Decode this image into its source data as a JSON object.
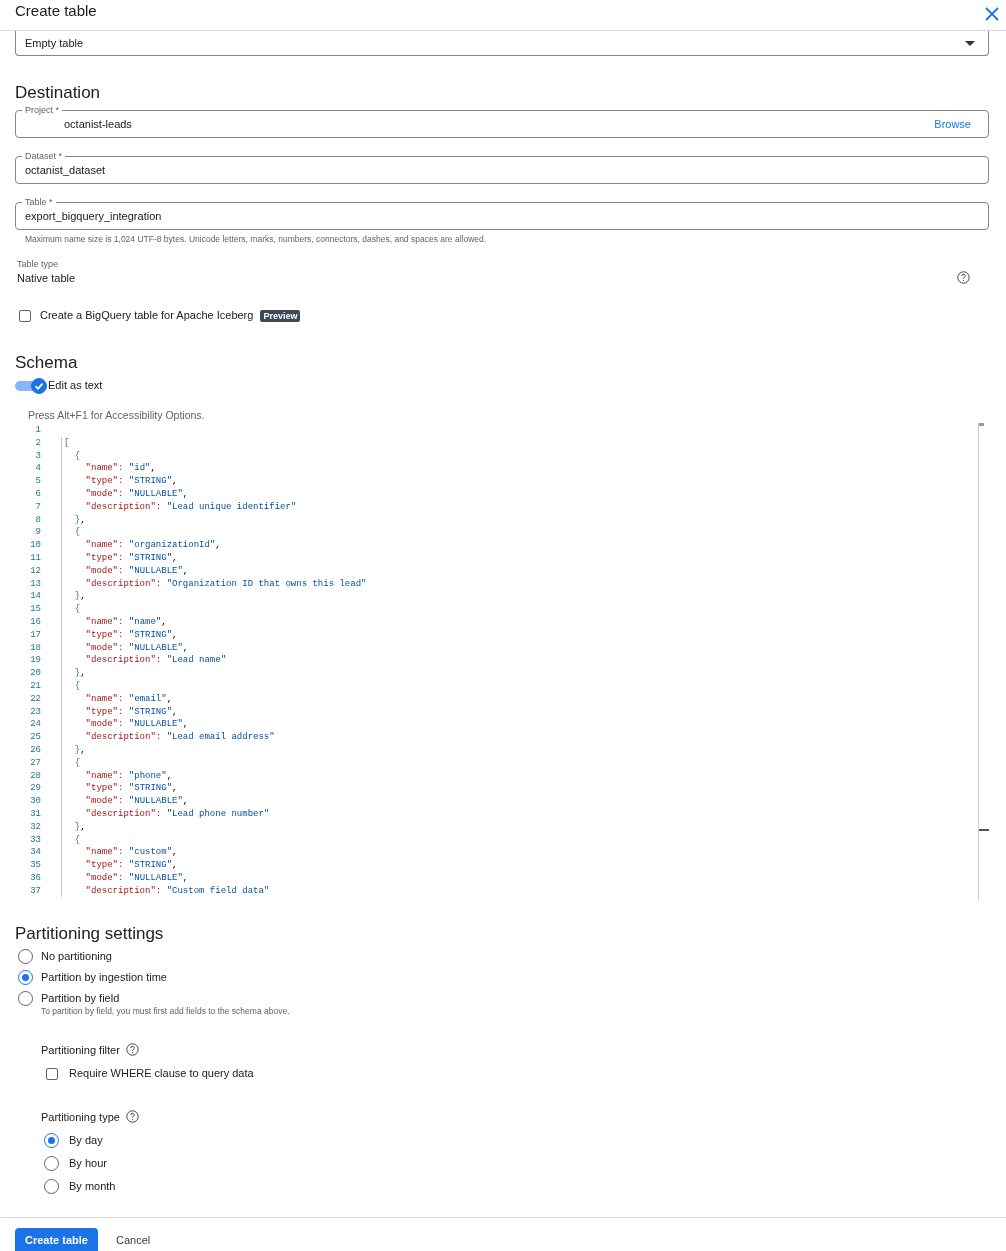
{
  "header": {
    "title": "Create table"
  },
  "source": {
    "value": "Empty table"
  },
  "destination": {
    "heading": "Destination",
    "fields": [
      {
        "label": "Project *",
        "value": "octanist-leads",
        "action": "Browse"
      },
      {
        "label": "Dataset *",
        "value": "octanist_dataset"
      },
      {
        "label": "Table *",
        "value": "export_bigquery_integration",
        "hint": "Maximum name size is 1,024 UTF-8 bytes. Unicode letters, marks, numbers, connectors, dashes, and spaces are allowed."
      }
    ],
    "table_type_label": "Table type",
    "table_type_value": "Native table",
    "iceberg": {
      "label": "Create a BigQuery table for Apache Iceberg",
      "checked": false,
      "badge": "Preview"
    }
  },
  "schema": {
    "heading": "Schema",
    "toggle": {
      "label": "Edit as text",
      "on": true
    },
    "editor_hint": "Press Alt+F1 for Accessibility Options.",
    "code_lines": [
      {
        "number": "1"
      },
      {
        "number": "2",
        "text": "["
      },
      {
        "number": "3",
        "text": "  {"
      },
      {
        "number": "4",
        "text": "    \"name\": \"id\","
      },
      {
        "number": "5",
        "text": "    \"type\": \"STRING\","
      },
      {
        "number": "6",
        "text": "    \"mode\": \"NULLABLE\","
      },
      {
        "number": "7",
        "text": "    \"description\": \"Lead unique identifier\""
      },
      {
        "number": "8",
        "text": "  },"
      },
      {
        "number": "9",
        "text": "  {"
      },
      {
        "number": "10",
        "text": "    \"name\": \"organizationId\","
      },
      {
        "number": "11",
        "text": "    \"type\": \"STRING\","
      },
      {
        "number": "12",
        "text": "    \"mode\": \"NULLABLE\","
      },
      {
        "number": "13",
        "text": "    \"description\": \"Organization ID that owns this lead\""
      },
      {
        "number": "14",
        "text": "  },"
      },
      {
        "number": "15",
        "text": "  {"
      },
      {
        "number": "16",
        "text": "    \"name\": \"name\","
      },
      {
        "number": "17",
        "text": "    \"type\": \"STRING\","
      },
      {
        "number": "18",
        "text": "    \"mode\": \"NULLABLE\","
      },
      {
        "number": "19",
        "text": "    \"description\": \"Lead name\""
      },
      {
        "number": "20",
        "text": "  },"
      },
      {
        "number": "21",
        "text": "  {"
      },
      {
        "number": "22",
        "text": "    \"name\": \"email\","
      },
      {
        "number": "23",
        "text": "    \"type\": \"STRING\","
      },
      {
        "number": "24",
        "text": "    \"mode\": \"NULLABLE\","
      },
      {
        "number": "25",
        "text": "    \"description\": \"Lead email address\""
      },
      {
        "number": "26",
        "text": "  },"
      },
      {
        "number": "27",
        "text": "  {"
      },
      {
        "number": "28",
        "text": "    \"name\": \"phone\","
      },
      {
        "number": "29",
        "text": "    \"type\": \"STRING\","
      },
      {
        "number": "30",
        "text": "    \"mode\": \"NULLABLE\","
      },
      {
        "number": "31",
        "text": "    \"description\": \"Lead phone number\""
      },
      {
        "number": "32",
        "text": "  },"
      },
      {
        "number": "33",
        "text": "  {"
      },
      {
        "number": "34",
        "text": "    \"name\": \"custom\","
      },
      {
        "number": "35",
        "text": "    \"type\": \"STRING\","
      },
      {
        "number": "36",
        "text": "    \"mode\": \"NULLABLE\","
      },
      {
        "number": "37",
        "text": "    \"description\": \"Custom field data\""
      }
    ]
  },
  "partitioning": {
    "heading": "Partitioning settings",
    "options": [
      {
        "label": "No partitioning",
        "selected": false
      },
      {
        "label": "Partition by ingestion time",
        "selected": true
      },
      {
        "label": "Partition by field",
        "selected": false,
        "hint": "To partition by field, you must first add fields to the schema above."
      }
    ],
    "filter": {
      "label": "Partitioning filter",
      "checkbox": {
        "label": "Require WHERE clause to query data",
        "checked": false
      }
    },
    "type": {
      "label": "Partitioning type",
      "options": [
        {
          "label": "By day",
          "selected": true
        },
        {
          "label": "By hour",
          "selected": false
        },
        {
          "label": "By month",
          "selected": false
        }
      ]
    }
  },
  "footer": {
    "buttons": [
      {
        "label": "Create table",
        "kind": "primary"
      },
      {
        "label": "Cancel",
        "kind": "text"
      }
    ]
  }
}
